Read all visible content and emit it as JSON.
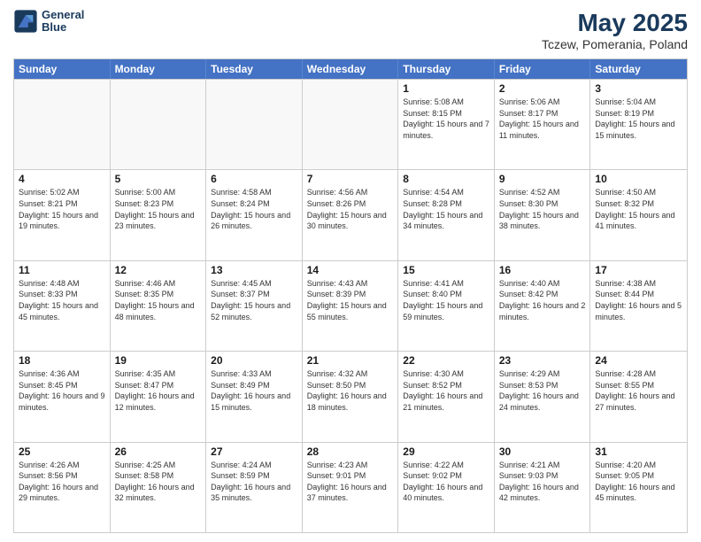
{
  "header": {
    "logo_line1": "General",
    "logo_line2": "Blue",
    "main_title": "May 2025",
    "subtitle": "Tczew, Pomerania, Poland"
  },
  "weekdays": [
    "Sunday",
    "Monday",
    "Tuesday",
    "Wednesday",
    "Thursday",
    "Friday",
    "Saturday"
  ],
  "rows": [
    [
      {
        "day": "",
        "empty": true
      },
      {
        "day": "",
        "empty": true
      },
      {
        "day": "",
        "empty": true
      },
      {
        "day": "",
        "empty": true
      },
      {
        "day": "1",
        "sunrise": "5:08 AM",
        "sunset": "8:15 PM",
        "daylight": "15 hours and 7 minutes."
      },
      {
        "day": "2",
        "sunrise": "5:06 AM",
        "sunset": "8:17 PM",
        "daylight": "15 hours and 11 minutes."
      },
      {
        "day": "3",
        "sunrise": "5:04 AM",
        "sunset": "8:19 PM",
        "daylight": "15 hours and 15 minutes."
      }
    ],
    [
      {
        "day": "4",
        "sunrise": "5:02 AM",
        "sunset": "8:21 PM",
        "daylight": "15 hours and 19 minutes."
      },
      {
        "day": "5",
        "sunrise": "5:00 AM",
        "sunset": "8:23 PM",
        "daylight": "15 hours and 23 minutes."
      },
      {
        "day": "6",
        "sunrise": "4:58 AM",
        "sunset": "8:24 PM",
        "daylight": "15 hours and 26 minutes."
      },
      {
        "day": "7",
        "sunrise": "4:56 AM",
        "sunset": "8:26 PM",
        "daylight": "15 hours and 30 minutes."
      },
      {
        "day": "8",
        "sunrise": "4:54 AM",
        "sunset": "8:28 PM",
        "daylight": "15 hours and 34 minutes."
      },
      {
        "day": "9",
        "sunrise": "4:52 AM",
        "sunset": "8:30 PM",
        "daylight": "15 hours and 38 minutes."
      },
      {
        "day": "10",
        "sunrise": "4:50 AM",
        "sunset": "8:32 PM",
        "daylight": "15 hours and 41 minutes."
      }
    ],
    [
      {
        "day": "11",
        "sunrise": "4:48 AM",
        "sunset": "8:33 PM",
        "daylight": "15 hours and 45 minutes."
      },
      {
        "day": "12",
        "sunrise": "4:46 AM",
        "sunset": "8:35 PM",
        "daylight": "15 hours and 48 minutes."
      },
      {
        "day": "13",
        "sunrise": "4:45 AM",
        "sunset": "8:37 PM",
        "daylight": "15 hours and 52 minutes."
      },
      {
        "day": "14",
        "sunrise": "4:43 AM",
        "sunset": "8:39 PM",
        "daylight": "15 hours and 55 minutes."
      },
      {
        "day": "15",
        "sunrise": "4:41 AM",
        "sunset": "8:40 PM",
        "daylight": "15 hours and 59 minutes."
      },
      {
        "day": "16",
        "sunrise": "4:40 AM",
        "sunset": "8:42 PM",
        "daylight": "16 hours and 2 minutes."
      },
      {
        "day": "17",
        "sunrise": "4:38 AM",
        "sunset": "8:44 PM",
        "daylight": "16 hours and 5 minutes."
      }
    ],
    [
      {
        "day": "18",
        "sunrise": "4:36 AM",
        "sunset": "8:45 PM",
        "daylight": "16 hours and 9 minutes."
      },
      {
        "day": "19",
        "sunrise": "4:35 AM",
        "sunset": "8:47 PM",
        "daylight": "16 hours and 12 minutes."
      },
      {
        "day": "20",
        "sunrise": "4:33 AM",
        "sunset": "8:49 PM",
        "daylight": "16 hours and 15 minutes."
      },
      {
        "day": "21",
        "sunrise": "4:32 AM",
        "sunset": "8:50 PM",
        "daylight": "16 hours and 18 minutes."
      },
      {
        "day": "22",
        "sunrise": "4:30 AM",
        "sunset": "8:52 PM",
        "daylight": "16 hours and 21 minutes."
      },
      {
        "day": "23",
        "sunrise": "4:29 AM",
        "sunset": "8:53 PM",
        "daylight": "16 hours and 24 minutes."
      },
      {
        "day": "24",
        "sunrise": "4:28 AM",
        "sunset": "8:55 PM",
        "daylight": "16 hours and 27 minutes."
      }
    ],
    [
      {
        "day": "25",
        "sunrise": "4:26 AM",
        "sunset": "8:56 PM",
        "daylight": "16 hours and 29 minutes."
      },
      {
        "day": "26",
        "sunrise": "4:25 AM",
        "sunset": "8:58 PM",
        "daylight": "16 hours and 32 minutes."
      },
      {
        "day": "27",
        "sunrise": "4:24 AM",
        "sunset": "8:59 PM",
        "daylight": "16 hours and 35 minutes."
      },
      {
        "day": "28",
        "sunrise": "4:23 AM",
        "sunset": "9:01 PM",
        "daylight": "16 hours and 37 minutes."
      },
      {
        "day": "29",
        "sunrise": "4:22 AM",
        "sunset": "9:02 PM",
        "daylight": "16 hours and 40 minutes."
      },
      {
        "day": "30",
        "sunrise": "4:21 AM",
        "sunset": "9:03 PM",
        "daylight": "16 hours and 42 minutes."
      },
      {
        "day": "31",
        "sunrise": "4:20 AM",
        "sunset": "9:05 PM",
        "daylight": "16 hours and 45 minutes."
      }
    ]
  ]
}
